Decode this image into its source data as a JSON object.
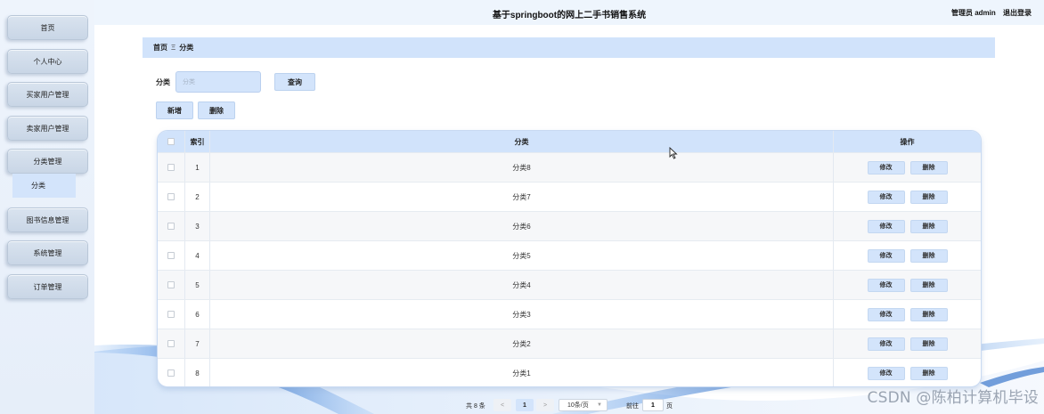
{
  "header": {
    "title": "基于springboot的网上二手书销售系统",
    "user_role": "管理员 admin",
    "logout": "退出登录"
  },
  "sidebar": {
    "items": [
      {
        "label": "首页"
      },
      {
        "label": "个人中心"
      },
      {
        "label": "买家用户管理"
      },
      {
        "label": "卖家用户管理"
      },
      {
        "label": "分类管理"
      },
      {
        "label": "图书信息管理"
      },
      {
        "label": "系统管理"
      },
      {
        "label": "订单管理"
      }
    ],
    "sub_item": "分类"
  },
  "breadcrumb": {
    "home": "首页",
    "separator": "Ξ",
    "current": "分类"
  },
  "search": {
    "label": "分类",
    "placeholder": "分类",
    "query_button": "查询"
  },
  "actions": {
    "add": "新增",
    "delete": "删除"
  },
  "table": {
    "columns": {
      "index": "索引",
      "category": "分类",
      "ops": "操作"
    },
    "rows": [
      {
        "index": "1",
        "category": "分类8"
      },
      {
        "index": "2",
        "category": "分类7"
      },
      {
        "index": "3",
        "category": "分类6"
      },
      {
        "index": "4",
        "category": "分类5"
      },
      {
        "index": "5",
        "category": "分类4"
      },
      {
        "index": "6",
        "category": "分类3"
      },
      {
        "index": "7",
        "category": "分类2"
      },
      {
        "index": "8",
        "category": "分类1"
      }
    ],
    "edit_label": "修改",
    "delete_label": "删除"
  },
  "pagination": {
    "total": "共 8 条",
    "prev": "<",
    "current_page": "1",
    "next": ">",
    "page_size": "10条/页",
    "goto_label": "前往",
    "goto_value": "1",
    "goto_suffix": "页"
  },
  "watermark": "CSDN @陈柏计算机毕设",
  "colors": {
    "accent": "#d3e4fb",
    "sidebar_button": "#d0dceb",
    "swoosh": "#2f6fc8"
  }
}
